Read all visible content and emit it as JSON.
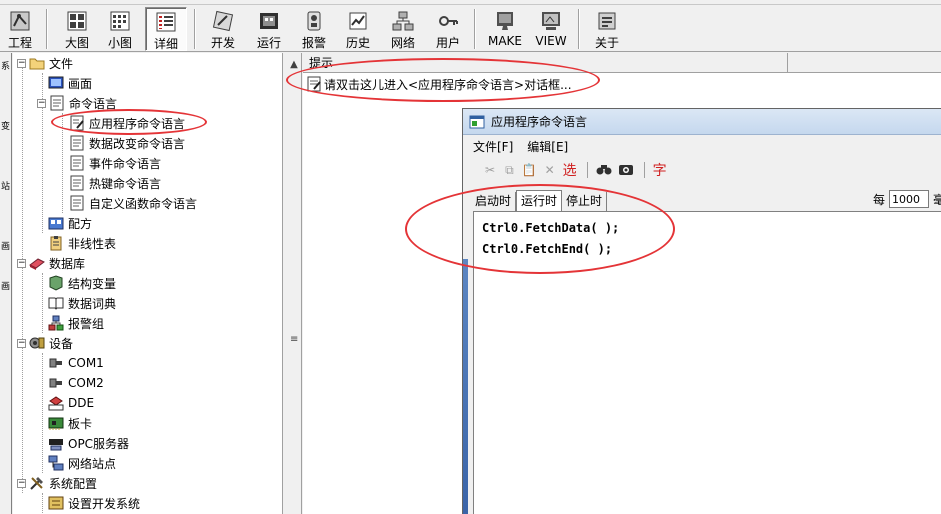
{
  "toolbar": {
    "buttons": [
      {
        "label": "工程",
        "icon": "project-icon"
      },
      {
        "label": "大图",
        "icon": "large-icons-view-icon"
      },
      {
        "label": "小图",
        "icon": "small-icons-view-icon"
      },
      {
        "label": "详细",
        "icon": "details-view-icon"
      },
      {
        "label": "开发",
        "icon": "develop-icon"
      },
      {
        "label": "运行",
        "icon": "run-icon"
      },
      {
        "label": "报警",
        "icon": "alarm-icon"
      },
      {
        "label": "历史",
        "icon": "history-icon"
      },
      {
        "label": "网络",
        "icon": "network-icon"
      },
      {
        "label": "用户",
        "icon": "user-icon"
      },
      {
        "label": "MAKE",
        "icon": "make-icon"
      },
      {
        "label": "VIEW",
        "icon": "view-icon"
      },
      {
        "label": "关于",
        "icon": "about-icon"
      }
    ]
  },
  "left_strip": {
    "fragments": [
      "系",
      "变",
      "站",
      "画",
      "画"
    ]
  },
  "tree": {
    "items": [
      {
        "label": "文件"
      },
      {
        "label": "画面"
      },
      {
        "label": "命令语言"
      },
      {
        "label": "应用程序命令语言"
      },
      {
        "label": "数据改变命令语言"
      },
      {
        "label": "事件命令语言"
      },
      {
        "label": "热键命令语言"
      },
      {
        "label": "自定义函数命令语言"
      },
      {
        "label": "配方"
      },
      {
        "label": "非线性表"
      },
      {
        "label": "数据库"
      },
      {
        "label": "结构变量"
      },
      {
        "label": "数据词典"
      },
      {
        "label": "报警组"
      },
      {
        "label": "设备"
      },
      {
        "label": "COM1"
      },
      {
        "label": "COM2"
      },
      {
        "label": "DDE"
      },
      {
        "label": "板卡"
      },
      {
        "label": "OPC服务器"
      },
      {
        "label": "网络站点"
      },
      {
        "label": "系统配置"
      },
      {
        "label": "设置开发系统"
      }
    ]
  },
  "right_panel": {
    "header": "提示",
    "hint_text": "请双击这儿进入<应用程序命令语言>对话框..."
  },
  "dialog": {
    "title": "应用程序命令语言",
    "menu": [
      "文件[F]",
      "编辑[E]"
    ],
    "tool_select_label": "选",
    "tool_char_label": "字",
    "tabs": [
      "启动时",
      "运行时",
      "停止时"
    ],
    "each_label": "每",
    "interval_value": "1000",
    "interval_suffix": "毫",
    "code_lines": [
      "Ctrl0.FetchData( );",
      "Ctrl0.FetchEnd( );"
    ]
  },
  "colors": {
    "annotation_ring": "#e43437",
    "selected_text_bg": "#ffffff"
  }
}
